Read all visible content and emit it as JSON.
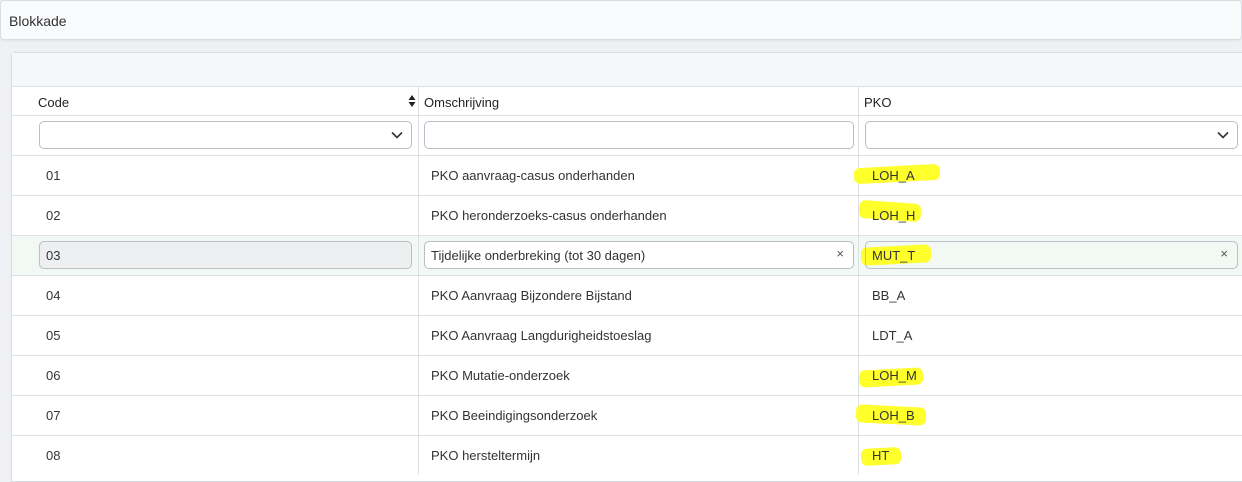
{
  "header": {
    "title": "Blokkade"
  },
  "table": {
    "columns": [
      "Code",
      "Omschrijving",
      "PKO"
    ],
    "filters": {
      "code": "",
      "omschrijving": "",
      "pko": ""
    },
    "rows": [
      {
        "code": "01",
        "omschrijving": "PKO aanvraag-casus onderhanden",
        "pko": "LOH_A"
      },
      {
        "code": "02",
        "omschrijving": "PKO heronderzoeks-casus onderhanden",
        "pko": "LOH_H"
      },
      {
        "code": "03",
        "omschrijving": "Tijdelijke onderbreking (tot 30 dagen)",
        "pko": "MUT_T"
      },
      {
        "code": "04",
        "omschrijving": "PKO Aanvraag Bijzondere Bijstand",
        "pko": "BB_A"
      },
      {
        "code": "05",
        "omschrijving": "PKO Aanvraag Langdurigheidstoeslag",
        "pko": "LDT_A"
      },
      {
        "code": "06",
        "omschrijving": "PKO Mutatie-onderzoek",
        "pko": "LOH_M"
      },
      {
        "code": "07",
        "omschrijving": "PKO Beeindigingsonderzoek",
        "pko": "LOH_B"
      },
      {
        "code": "08",
        "omschrijving": "PKO hersteltermijn",
        "pko": "HT"
      }
    ],
    "clear_glyph": "×",
    "highlight_color": "#ffff20"
  },
  "icons": {
    "sort": "sort-icon",
    "dropdown": "chevron-down-icon",
    "clear": "clear-icon"
  }
}
